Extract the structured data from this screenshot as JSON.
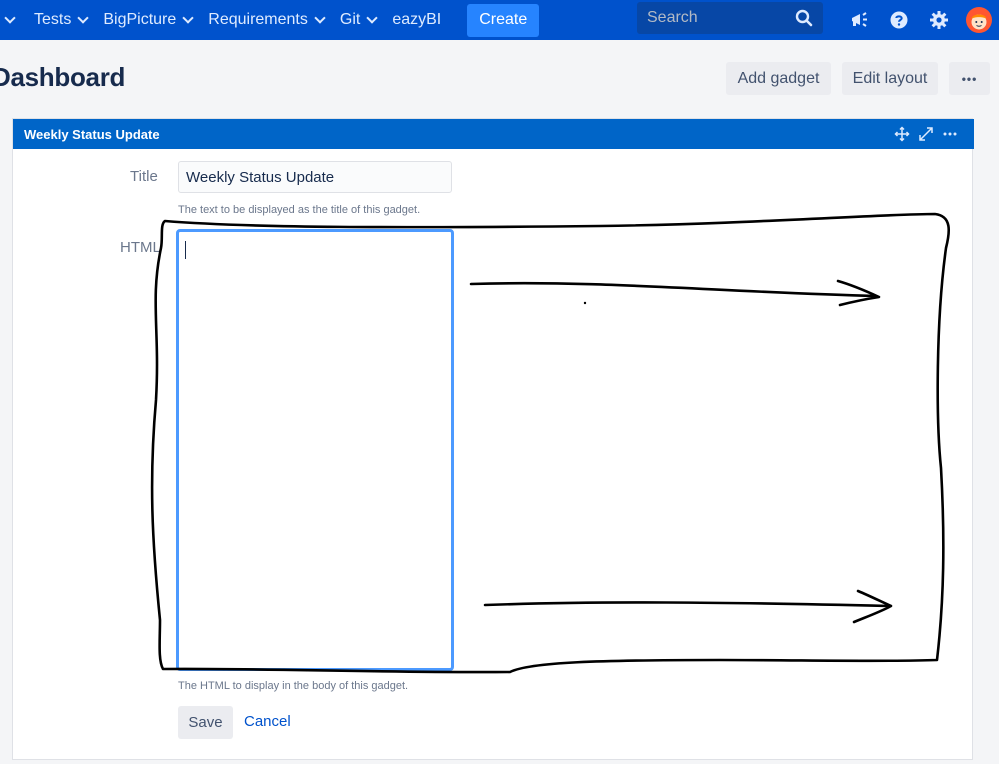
{
  "nav": {
    "items": [
      {
        "label": "Tests"
      },
      {
        "label": "BigPicture"
      },
      {
        "label": "Requirements"
      },
      {
        "label": "Git"
      }
    ],
    "plain_item": "eazyBI",
    "create_label": "Create",
    "search_placeholder": "Search",
    "brand_color": "#0052cc"
  },
  "header": {
    "title": "Dashboard",
    "add_gadget_label": "Add gadget",
    "edit_layout_label": "Edit layout",
    "more_label": "•••"
  },
  "gadget": {
    "header_title": "Weekly Status Update",
    "header_color": "#0065c8",
    "title_label": "Title",
    "title_value": "Weekly Status Update",
    "title_help": "The text to be displayed as the title of this gadget.",
    "html_label": "HTML",
    "html_value": "",
    "html_help": "The HTML to display in the body of this gadget.",
    "save_label": "Save",
    "cancel_label": "Cancel"
  }
}
